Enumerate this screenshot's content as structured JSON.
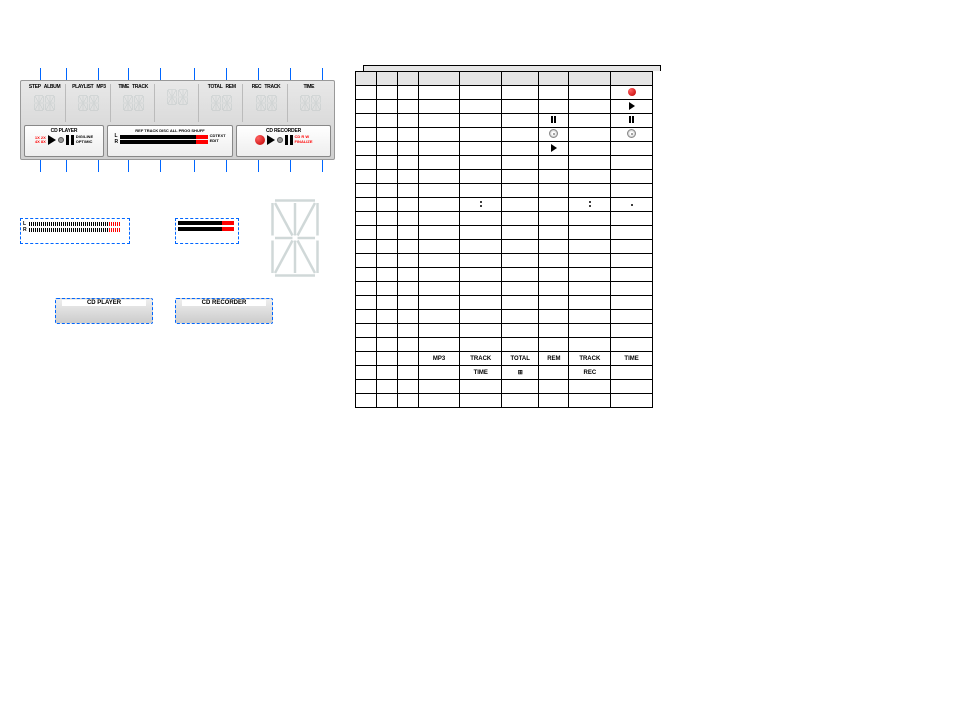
{
  "panel": {
    "groups": [
      {
        "labels": [
          "STEP",
          "ALBUM"
        ],
        "digits": 2
      },
      {
        "labels": [
          "PLAYLIST",
          "MP3"
        ],
        "digits": 2
      },
      {
        "labels": [
          "TIME",
          "TRACK"
        ],
        "digits": 2
      },
      {
        "labels": [
          "",
          ""
        ],
        "digits": 2
      },
      {
        "labels": [
          "TOTAL",
          "REM"
        ],
        "digits": 2
      },
      {
        "labels": [
          "REC",
          "TRACK"
        ],
        "digits": 2
      },
      {
        "labels": [
          "TIME",
          ""
        ],
        "digits": 2
      }
    ],
    "player": {
      "title": "CD PLAYER",
      "speeds": [
        "1X 2X",
        "4X 8X"
      ],
      "info": [
        "DIG/LINE",
        "OPT/MIC"
      ]
    },
    "meter": {
      "scale": [
        "REF",
        "TRACK",
        "DISC",
        "ALL",
        "PROG",
        "SHUFF"
      ],
      "lr": [
        "L",
        "R"
      ],
      "side": [
        "CDTEXT",
        "EDIT"
      ]
    },
    "recorder": {
      "title": "CD RECORDER",
      "side": [
        "CD R W",
        "FINALIZE"
      ]
    }
  },
  "floats": {
    "meter_lr": [
      "L",
      "R"
    ],
    "cd_player": "CD PLAYER",
    "cd_recorder": "CD RECORDER"
  },
  "grid": {
    "labels_row": [
      "",
      "",
      "",
      "MP3",
      "TRACK",
      "TOTAL",
      "REM",
      "TRACK",
      "TIME"
    ],
    "labels_row2": [
      "",
      "",
      "",
      "",
      "TIME",
      "⊞",
      "",
      "REC",
      ""
    ],
    "rows_before_labels": 19,
    "rows_after_labels": 2,
    "icons": {
      "r2c9_rec": true,
      "r3c9_play": true,
      "r4c7_pause": true,
      "r4c9_pause": true,
      "r5c7_disc": true,
      "r5c9_disc": true,
      "r6c7_play": true,
      "r10c5_colon": true,
      "r10c8_colon": true,
      "r10c9_dot": true
    }
  },
  "guide_lines_x": [
    40,
    66,
    98,
    128,
    160,
    194,
    226,
    258,
    290,
    322
  ],
  "colors": {
    "accent_blue": "#0066ff",
    "accent_red": "#cc0000"
  }
}
